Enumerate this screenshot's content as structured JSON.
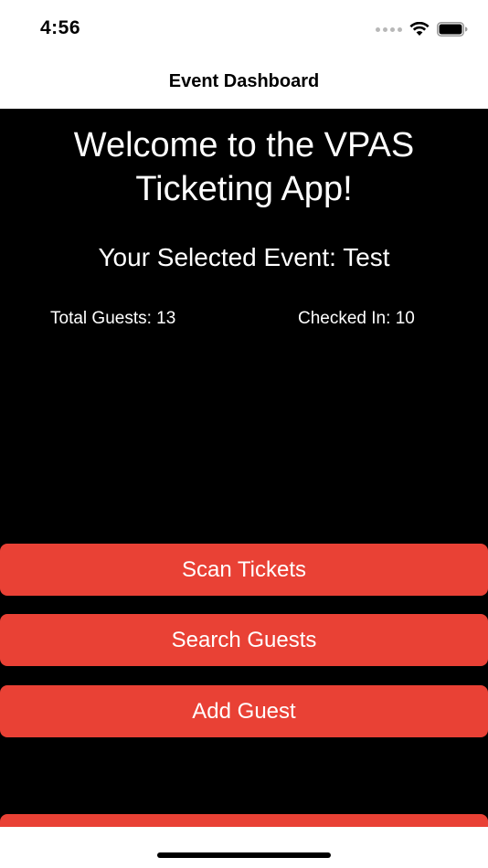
{
  "status_bar": {
    "time": "4:56",
    "icons": [
      "signal-dots-icon",
      "wifi-icon",
      "battery-icon"
    ]
  },
  "nav": {
    "title": "Event Dashboard"
  },
  "main": {
    "welcome_text": "Welcome to the VPAS Ticketing App!",
    "selected_event_label": "Your Selected Event:",
    "selected_event_name": "Test",
    "total_guests_label": "Total Guests:",
    "total_guests_value": "13",
    "checked_in_label": "Checked In:",
    "checked_in_value": "10"
  },
  "buttons": {
    "scan_label": "Scan Tickets",
    "search_label": "Search Guests",
    "add_label": "Add Guest"
  },
  "colors": {
    "accent": "#e94135",
    "background": "#000000",
    "text": "#ffffff"
  }
}
